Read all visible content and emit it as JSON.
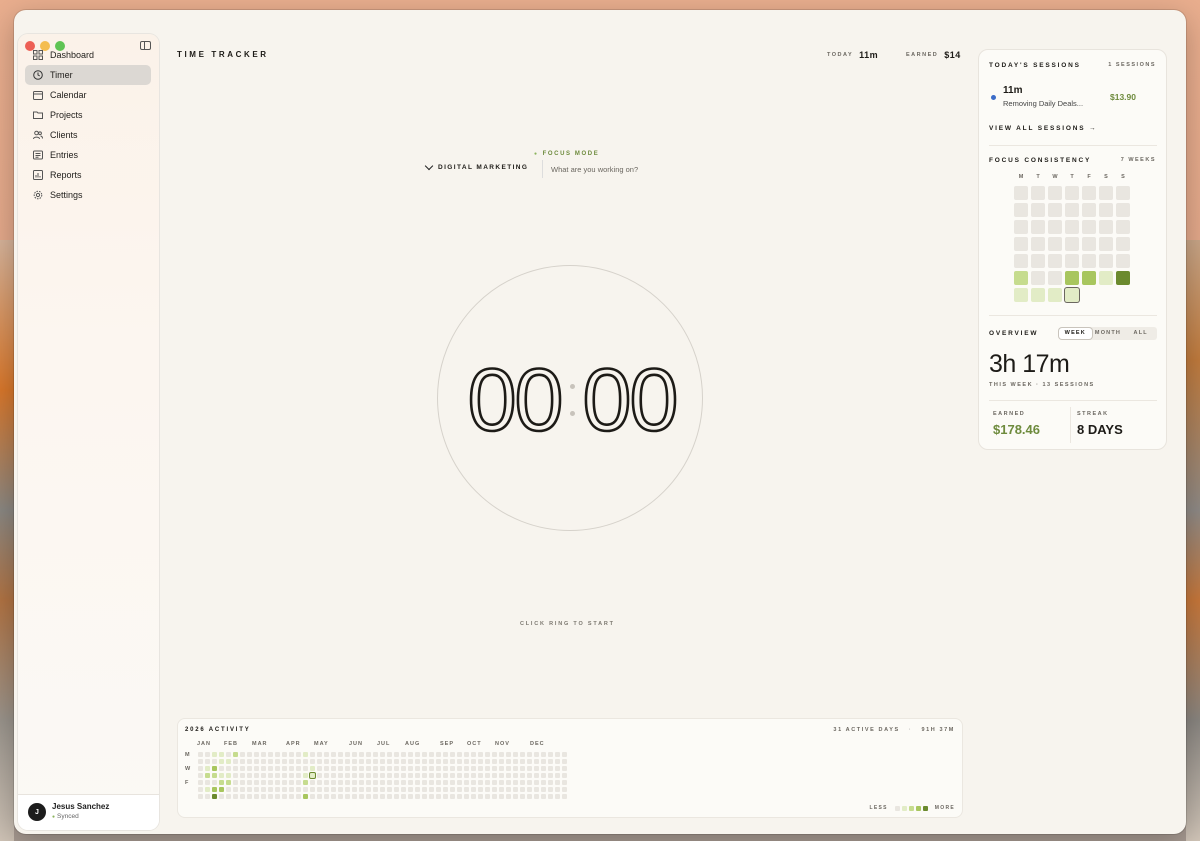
{
  "sidebar": {
    "items": [
      {
        "label": "Dashboard",
        "icon": "grid-icon"
      },
      {
        "label": "Timer",
        "icon": "clock-icon"
      },
      {
        "label": "Calendar",
        "icon": "calendar-icon"
      },
      {
        "label": "Projects",
        "icon": "folder-icon"
      },
      {
        "label": "Clients",
        "icon": "users-icon"
      },
      {
        "label": "Entries",
        "icon": "list-icon"
      },
      {
        "label": "Reports",
        "icon": "report-icon"
      },
      {
        "label": "Settings",
        "icon": "gear-icon"
      }
    ],
    "active": "Timer",
    "user": {
      "initial": "J",
      "name": "Jesus Sanchez",
      "status": "Synced"
    }
  },
  "header": {
    "title": "TIME TRACKER",
    "today_label": "TODAY",
    "today_value": "11m",
    "earned_label": "EARNED",
    "earned_value": "$14"
  },
  "timer": {
    "mode": "FOCUS MODE",
    "project": "DIGITAL MARKETING",
    "task_placeholder": "What are you working on?",
    "minutes": "00",
    "seconds": "00",
    "hint": "CLICK RING TO START"
  },
  "activity": {
    "title": "2026 ACTIVITY",
    "active_days": "31 ACTIVE DAYS",
    "total": "91H 37M",
    "months": [
      "JAN",
      "FEB",
      "MAR",
      "APR",
      "MAY",
      "JUN",
      "JUL",
      "AUG",
      "SEP",
      "OCT",
      "NOV",
      "DEC"
    ],
    "day_labels": [
      "M",
      "W",
      "F"
    ],
    "legend_less": "LESS",
    "legend_more": "MORE"
  },
  "sessions": {
    "title": "TODAY'S SESSIONS",
    "count": "1 SESSIONS",
    "items": [
      {
        "duration": "11m",
        "name": "Removing Daily Deals...",
        "amount": "$13.90"
      }
    ],
    "view_all": "VIEW ALL SESSIONS →"
  },
  "consistency": {
    "title": "FOCUS CONSISTENCY",
    "range": "7 WEEKS",
    "weekdays": [
      "M",
      "T",
      "W",
      "T",
      "F",
      "S",
      "S"
    ]
  },
  "overview": {
    "title": "OVERVIEW",
    "tabs": [
      "WEEK",
      "MONTH",
      "ALL"
    ],
    "active_tab": "WEEK",
    "total": "3h 17m",
    "subtitle": "THIS WEEK · 13 SESSIONS",
    "earned_label": "EARNED",
    "earned_value": "$178.46",
    "streak_label": "STREAK",
    "streak_value": "8 DAYS"
  },
  "colors": {
    "accent_green": "#6e8b3d",
    "blue_dot": "#3b6cc8",
    "heat": [
      "#e9e6e0",
      "#e2ecc6",
      "#c6dc8e",
      "#a8c65e",
      "#6b8a2e"
    ]
  }
}
